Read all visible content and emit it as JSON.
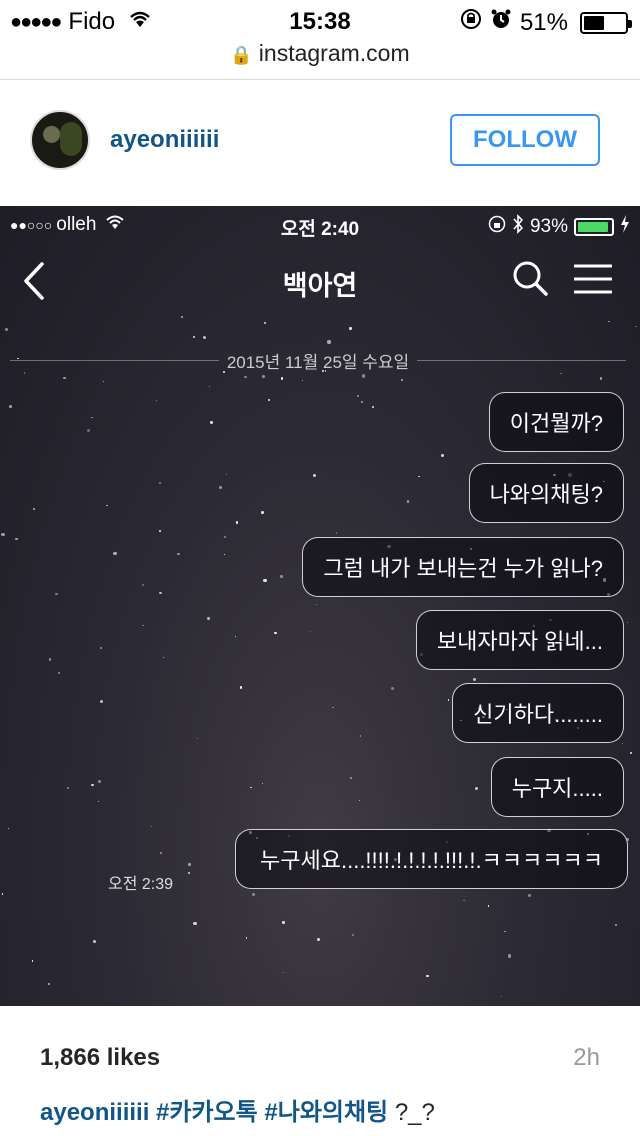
{
  "status_bar": {
    "signal_dots": "●●●●●",
    "carrier": "Fido",
    "time": "15:38",
    "battery_percent": "51%",
    "battery_level": 0.51
  },
  "browser": {
    "url": "instagram.com"
  },
  "post": {
    "username": "ayeoniiiiii",
    "follow_label": "FOLLOW",
    "likes": "1,866 likes",
    "time_ago": "2h",
    "caption_user": "ayeoniiiiii",
    "caption_tags": [
      "#카카오톡",
      "#나와의채팅"
    ],
    "caption_text": "?_?"
  },
  "chat": {
    "status_bar": {
      "signal": "●●○○○",
      "carrier": "olleh",
      "time": "오전 2:40",
      "battery_percent": "93%",
      "battery_level": 0.93
    },
    "title": "백아연",
    "date_separator": "2015년 11월 25일 수요일",
    "messages": [
      {
        "text": "이건뭘까?"
      },
      {
        "text": "나와의채팅?"
      },
      {
        "text": "그럼 내가 보내는건 누가 읽나?"
      },
      {
        "text": "보내자마자 읽네..."
      },
      {
        "text": "신기하다........"
      },
      {
        "text": "누구지....."
      },
      {
        "text": "누구세요....!!!!.!.!.!.!.!!!.!.ㅋㅋㅋㅋㅋㅋ"
      }
    ],
    "last_message_time": "오전 2:39"
  },
  "colors": {
    "link": "#125688",
    "follow": "#3897f0",
    "battery_green": "#4cd964"
  }
}
